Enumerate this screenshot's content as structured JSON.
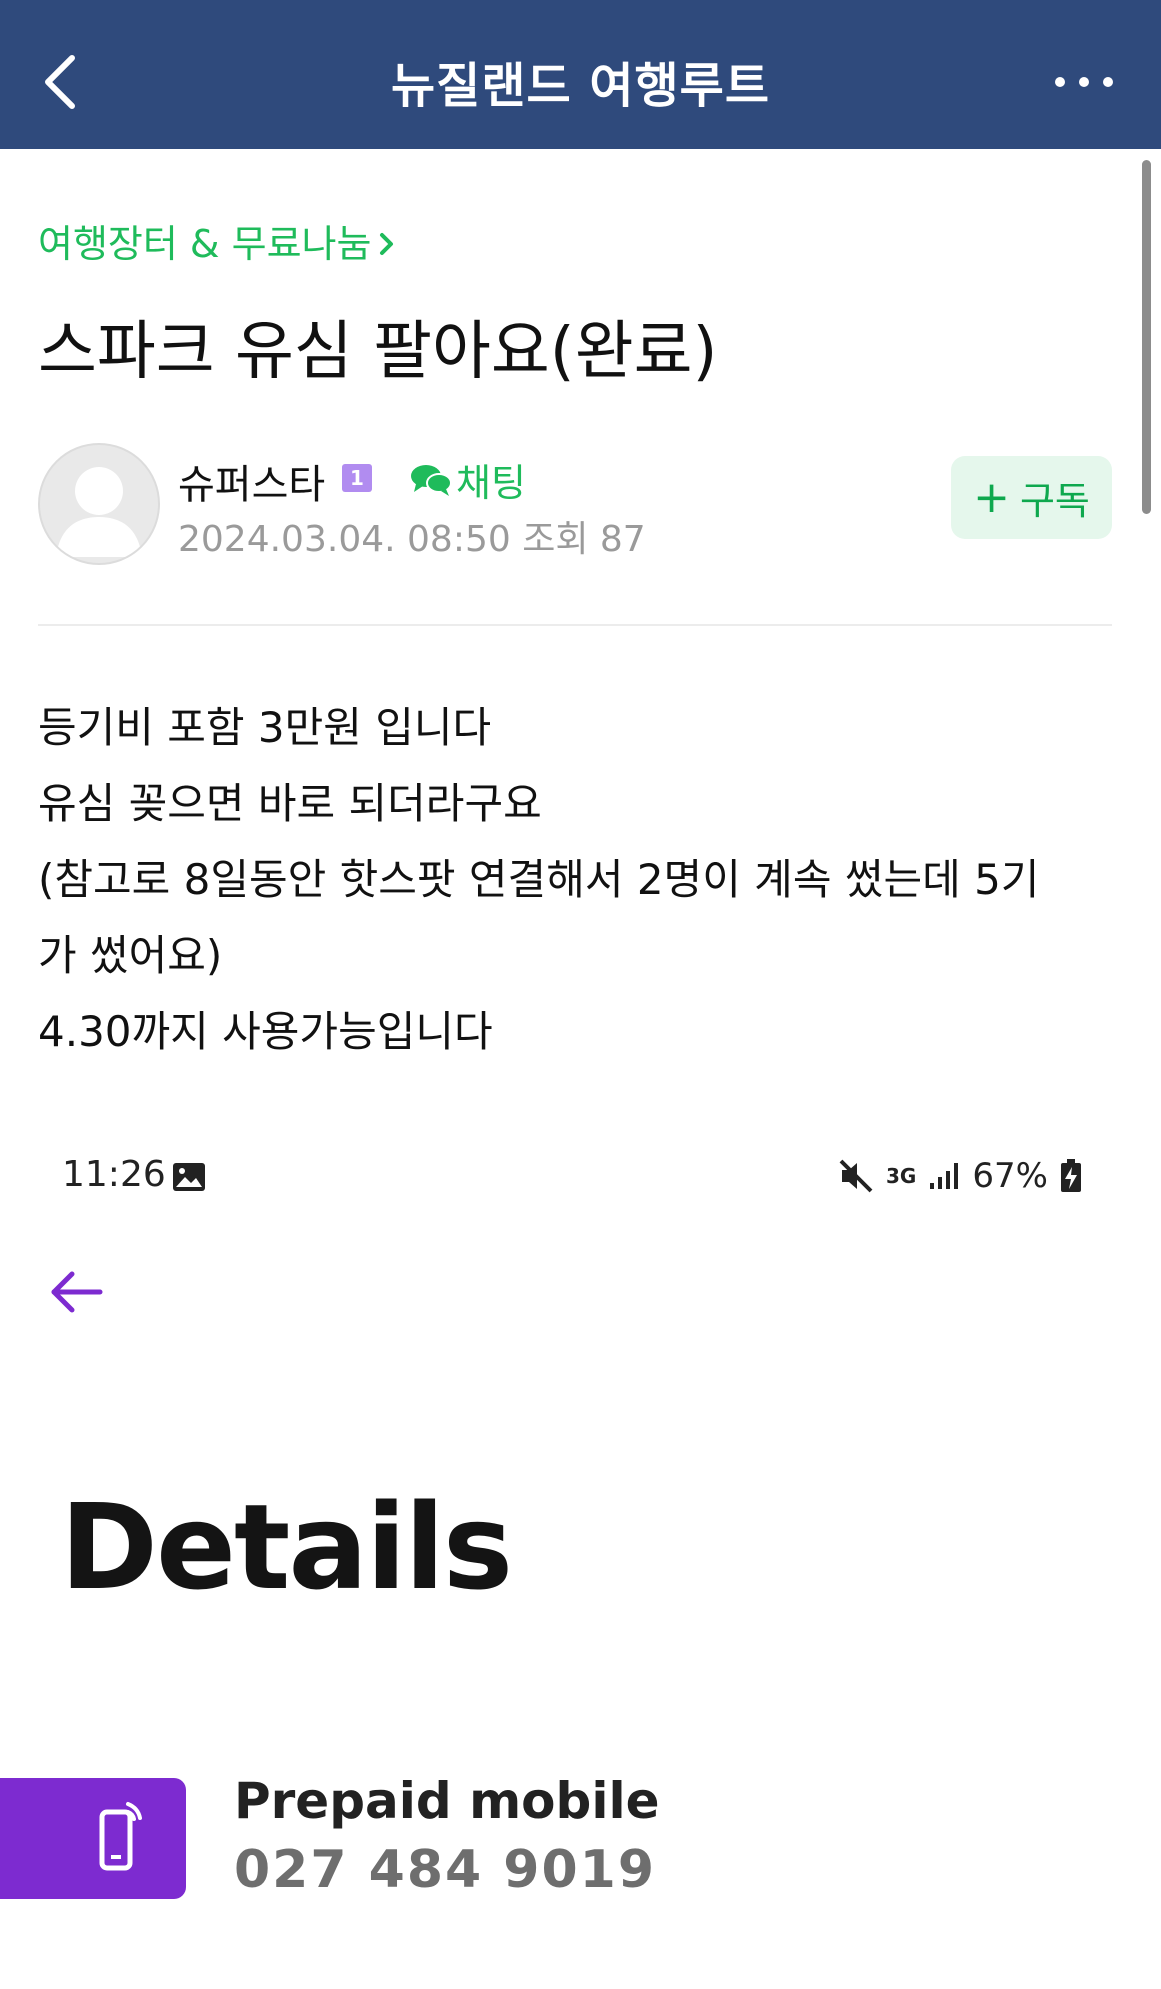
{
  "header": {
    "title": "뉴질랜드 여행루트"
  },
  "post": {
    "category": "여행장터 & 무료나눔",
    "title": "스파크 유심 팔아요(완료)",
    "author": {
      "name": "슈퍼스타",
      "level": "1",
      "chat_label": "채팅",
      "date": "2024.03.04. 08:50",
      "views_label": "조회 87"
    },
    "subscribe_label": "구독",
    "body_lines": [
      "등기비 포함 3만원 입니다",
      "유심 꽂으면 바로 되더라구요",
      "(참고로 8일동안 핫스팟 연결해서 2명이 계속 썼는데 5기",
      "가 썼어요)",
      "4.30까지 사용가능입니다"
    ]
  },
  "screenshot": {
    "time": "11:26",
    "network": "3G",
    "battery": "67%",
    "heading": "Details",
    "plan_label": "Prepaid mobile",
    "phone_number": "027 484 9019"
  },
  "colors": {
    "header_bg": "#2f4a7c",
    "accent_green": "#1fbb5b",
    "badge_purple": "#b18cf0",
    "shot_purple": "#7d2bd0"
  }
}
